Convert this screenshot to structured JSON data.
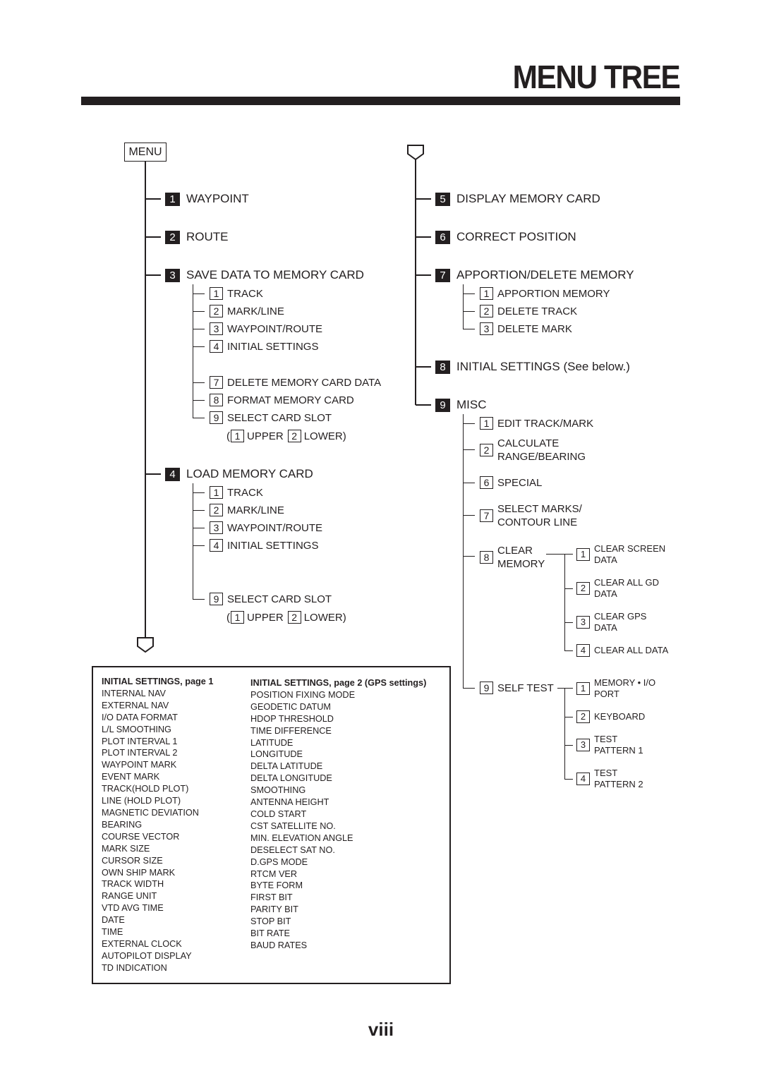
{
  "page": {
    "title": "MENU TREE",
    "page_number": "viii"
  },
  "root": {
    "label": "MENU"
  },
  "left_tree": [
    {
      "num": "1",
      "label": "WAYPOINT"
    },
    {
      "num": "2",
      "label": "ROUTE"
    },
    {
      "num": "3",
      "label": "SAVE DATA TO MEMORY CARD",
      "children": [
        {
          "num": "1",
          "label": "TRACK"
        },
        {
          "num": "2",
          "label": "MARK/LINE"
        },
        {
          "num": "3",
          "label": "WAYPOINT/ROUTE"
        },
        {
          "num": "4",
          "label": "INITIAL SETTINGS"
        },
        {
          "num": "7",
          "label": "DELETE MEMORY CARD DATA"
        },
        {
          "num": "8",
          "label": "FORMAT MEMORY CARD"
        },
        {
          "num": "9",
          "label": "SELECT CARD SLOT"
        }
      ],
      "slot_options": {
        "open": "(",
        "opt1_num": "1",
        "opt1": "UPPER",
        "opt2_num": "2",
        "opt2": "LOWER)"
      }
    },
    {
      "num": "4",
      "label": "LOAD MEMORY CARD",
      "children": [
        {
          "num": "1",
          "label": "TRACK"
        },
        {
          "num": "2",
          "label": "MARK/LINE"
        },
        {
          "num": "3",
          "label": "WAYPOINT/ROUTE"
        },
        {
          "num": "4",
          "label": "INITIAL SETTINGS"
        },
        {
          "num": "9",
          "label": "SELECT CARD SLOT"
        }
      ],
      "slot_options": {
        "open": "(",
        "opt1_num": "1",
        "opt1": "UPPER",
        "opt2_num": "2",
        "opt2": "LOWER)"
      }
    }
  ],
  "right_tree": [
    {
      "num": "5",
      "label": "DISPLAY MEMORY CARD"
    },
    {
      "num": "6",
      "label": "CORRECT POSITION"
    },
    {
      "num": "7",
      "label": "APPORTION/DELETE MEMORY",
      "children": [
        {
          "num": "1",
          "label": "APPORTION MEMORY"
        },
        {
          "num": "2",
          "label": "DELETE TRACK"
        },
        {
          "num": "3",
          "label": "DELETE MARK"
        }
      ]
    },
    {
      "num": "8",
      "label": "INITIAL SETTINGS (See below.)"
    },
    {
      "num": "9",
      "label": "MISC",
      "children": [
        {
          "num": "1",
          "label": "EDIT TRACK/MARK"
        },
        {
          "num": "2",
          "label_l1": "CALCULATE",
          "label_l2": "RANGE/BEARING"
        },
        {
          "num": "6",
          "label": "SPECIAL"
        },
        {
          "num": "7",
          "label_l1": "SELECT MARKS/",
          "label_l2": "CONTOUR LINE"
        },
        {
          "num": "8",
          "label_l1": "CLEAR",
          "label_l2": "MEMORY",
          "children": [
            {
              "num": "1",
              "label_l1": "CLEAR SCREEN",
              "label_l2": "DATA"
            },
            {
              "num": "2",
              "label_l1": "CLEAR ALL GD",
              "label_l2": "DATA"
            },
            {
              "num": "3",
              "label_l1": "CLEAR GPS",
              "label_l2": "DATA"
            },
            {
              "num": "4",
              "label": "CLEAR ALL DATA"
            }
          ]
        },
        {
          "num": "9",
          "label": "SELF TEST",
          "children": [
            {
              "num": "1",
              "label_l1": "MEMORY • I/O",
              "label_l2": "PORT"
            },
            {
              "num": "2",
              "label": "KEYBOARD"
            },
            {
              "num": "3",
              "label_l1": "TEST",
              "label_l2": "PATTERN 1"
            },
            {
              "num": "4",
              "label_l1": "TEST",
              "label_l2": "PATTERN 2"
            }
          ]
        }
      ]
    }
  ],
  "initial_settings": {
    "page1": {
      "heading": "INITIAL SETTINGS, page 1",
      "items": [
        "INTERNAL NAV",
        "EXTERNAL NAV",
        "I/O DATA FORMAT",
        "L/L SMOOTHING",
        "PLOT INTERVAL 1",
        "PLOT INTERVAL 2",
        "WAYPOINT MARK",
        "EVENT MARK",
        "TRACK(HOLD PLOT)",
        "LINE (HOLD PLOT)",
        "MAGNETIC DEVIATION",
        "BEARING",
        "COURSE VECTOR",
        "MARK SIZE",
        "CURSOR SIZE",
        "OWN SHIP MARK",
        "TRACK WIDTH",
        "RANGE UNIT",
        "VTD AVG TIME",
        "DATE",
        "TIME",
        "EXTERNAL CLOCK",
        "AUTOPILOT DISPLAY",
        "TD INDICATION"
      ]
    },
    "page2": {
      "heading": "INITIAL SETTINGS, page 2 (GPS settings)",
      "items": [
        "POSITION FIXING MODE",
        "GEODETIC DATUM",
        "HDOP THRESHOLD",
        "TIME DIFFERENCE",
        "LATITUDE",
        "LONGITUDE",
        "DELTA LATITUDE",
        "DELTA LONGITUDE",
        "SMOOTHING",
        "ANTENNA HEIGHT",
        "COLD START",
        "CST SATELLITE NO.",
        "MIN. ELEVATION ANGLE",
        "DESELECT SAT NO.",
        "D.GPS MODE",
        "RTCM VER",
        "BYTE FORM",
        "FIRST BIT",
        "PARITY BIT",
        "STOP BIT",
        "BIT RATE",
        "BAUD RATES"
      ]
    }
  }
}
